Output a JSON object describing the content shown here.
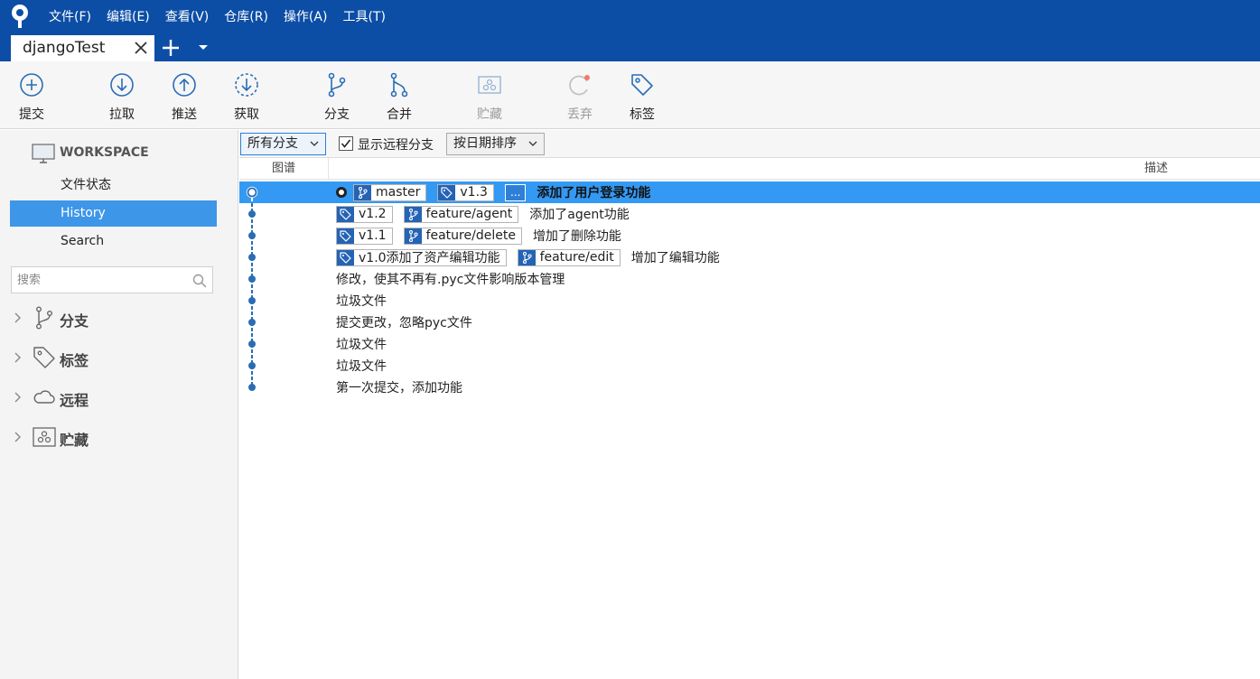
{
  "app": {
    "menu": [
      "文件(F)",
      "编辑(E)",
      "查看(V)",
      "仓库(R)",
      "操作(A)",
      "工具(T)"
    ],
    "tab": {
      "title": "djangoTest"
    }
  },
  "toolbar": {
    "commit": "提交",
    "pull": "拉取",
    "push": "推送",
    "fetch": "获取",
    "branch": "分支",
    "merge": "合并",
    "stash": "贮藏",
    "discard": "丢弃",
    "tag": "标签"
  },
  "sidebar": {
    "workspace": "WORKSPACE",
    "nav": [
      "文件状态",
      "History",
      "Search"
    ],
    "search_placeholder": "搜索",
    "tree": [
      "分支",
      "标签",
      "远程",
      "贮藏"
    ]
  },
  "filters": {
    "branches": "所有分支",
    "show_remote": "显示远程分支",
    "show_remote_checked": true,
    "sort": "按日期排序"
  },
  "columns": {
    "graph": "图谱",
    "description": "描述"
  },
  "commits": [
    {
      "head": true,
      "refs": [
        {
          "type": "branch",
          "name": "master"
        },
        {
          "type": "tag",
          "name": "v1.3"
        },
        {
          "type": "more",
          "name": "..."
        }
      ],
      "message": "添加了用户登录功能",
      "selected": true
    },
    {
      "refs": [
        {
          "type": "tag",
          "name": "v1.2"
        },
        {
          "type": "branch",
          "name": "feature/agent"
        }
      ],
      "message": "添加了agent功能"
    },
    {
      "refs": [
        {
          "type": "tag",
          "name": "v1.1"
        },
        {
          "type": "branch",
          "name": "feature/delete"
        }
      ],
      "message": "增加了删除功能"
    },
    {
      "refs": [
        {
          "type": "tag",
          "name": "v1.0添加了资产编辑功能"
        },
        {
          "type": "branch",
          "name": "feature/edit"
        }
      ],
      "message": "增加了编辑功能"
    },
    {
      "refs": [],
      "message": "修改，使其不再有.pyc文件影响版本管理"
    },
    {
      "refs": [],
      "message": "垃圾文件"
    },
    {
      "refs": [],
      "message": "提交更改，忽略pyc文件"
    },
    {
      "refs": [],
      "message": "垃圾文件"
    },
    {
      "refs": [],
      "message": "垃圾文件"
    },
    {
      "refs": [],
      "message": "第一次提交，添加功能"
    }
  ],
  "colors": {
    "titlebar": "#0c4ea6",
    "selection": "#3399f3",
    "sidebar_active": "#3d96e8",
    "graph": "#2a6db5",
    "ref_icon": "#2563b5"
  }
}
